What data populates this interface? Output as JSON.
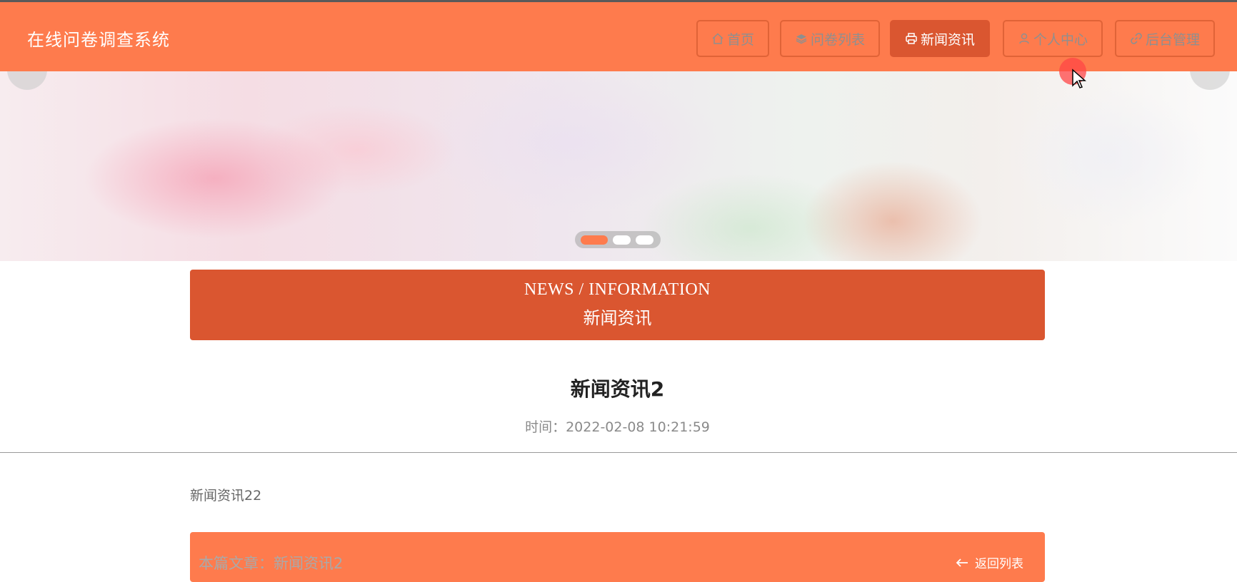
{
  "header": {
    "site_title": "在线问卷调查系统",
    "nav": [
      {
        "label": "首页",
        "icon": "home-icon",
        "active": false
      },
      {
        "label": "问卷列表",
        "icon": "layers-icon",
        "active": false
      },
      {
        "label": "新闻资讯",
        "icon": "printer-icon",
        "active": true
      },
      {
        "label": "个人中心",
        "icon": "user-icon",
        "active": false
      },
      {
        "label": "后台管理",
        "icon": "link-icon",
        "active": false
      }
    ]
  },
  "banner": {
    "slide_count": 3,
    "active_slide": 1
  },
  "section": {
    "title_en": "NEWS / INFORMATION",
    "title_cn": "新闻资讯"
  },
  "article": {
    "title": "新闻资讯2",
    "time": "时间：2022-02-08 10:21:59",
    "body": "新闻资讯22"
  },
  "footer": {
    "current_article": "本篇文章：新闻资讯2",
    "back_label": "返回列表"
  },
  "colors": {
    "accent": "#FE7B4D",
    "accent_dark": "#DA5630"
  }
}
